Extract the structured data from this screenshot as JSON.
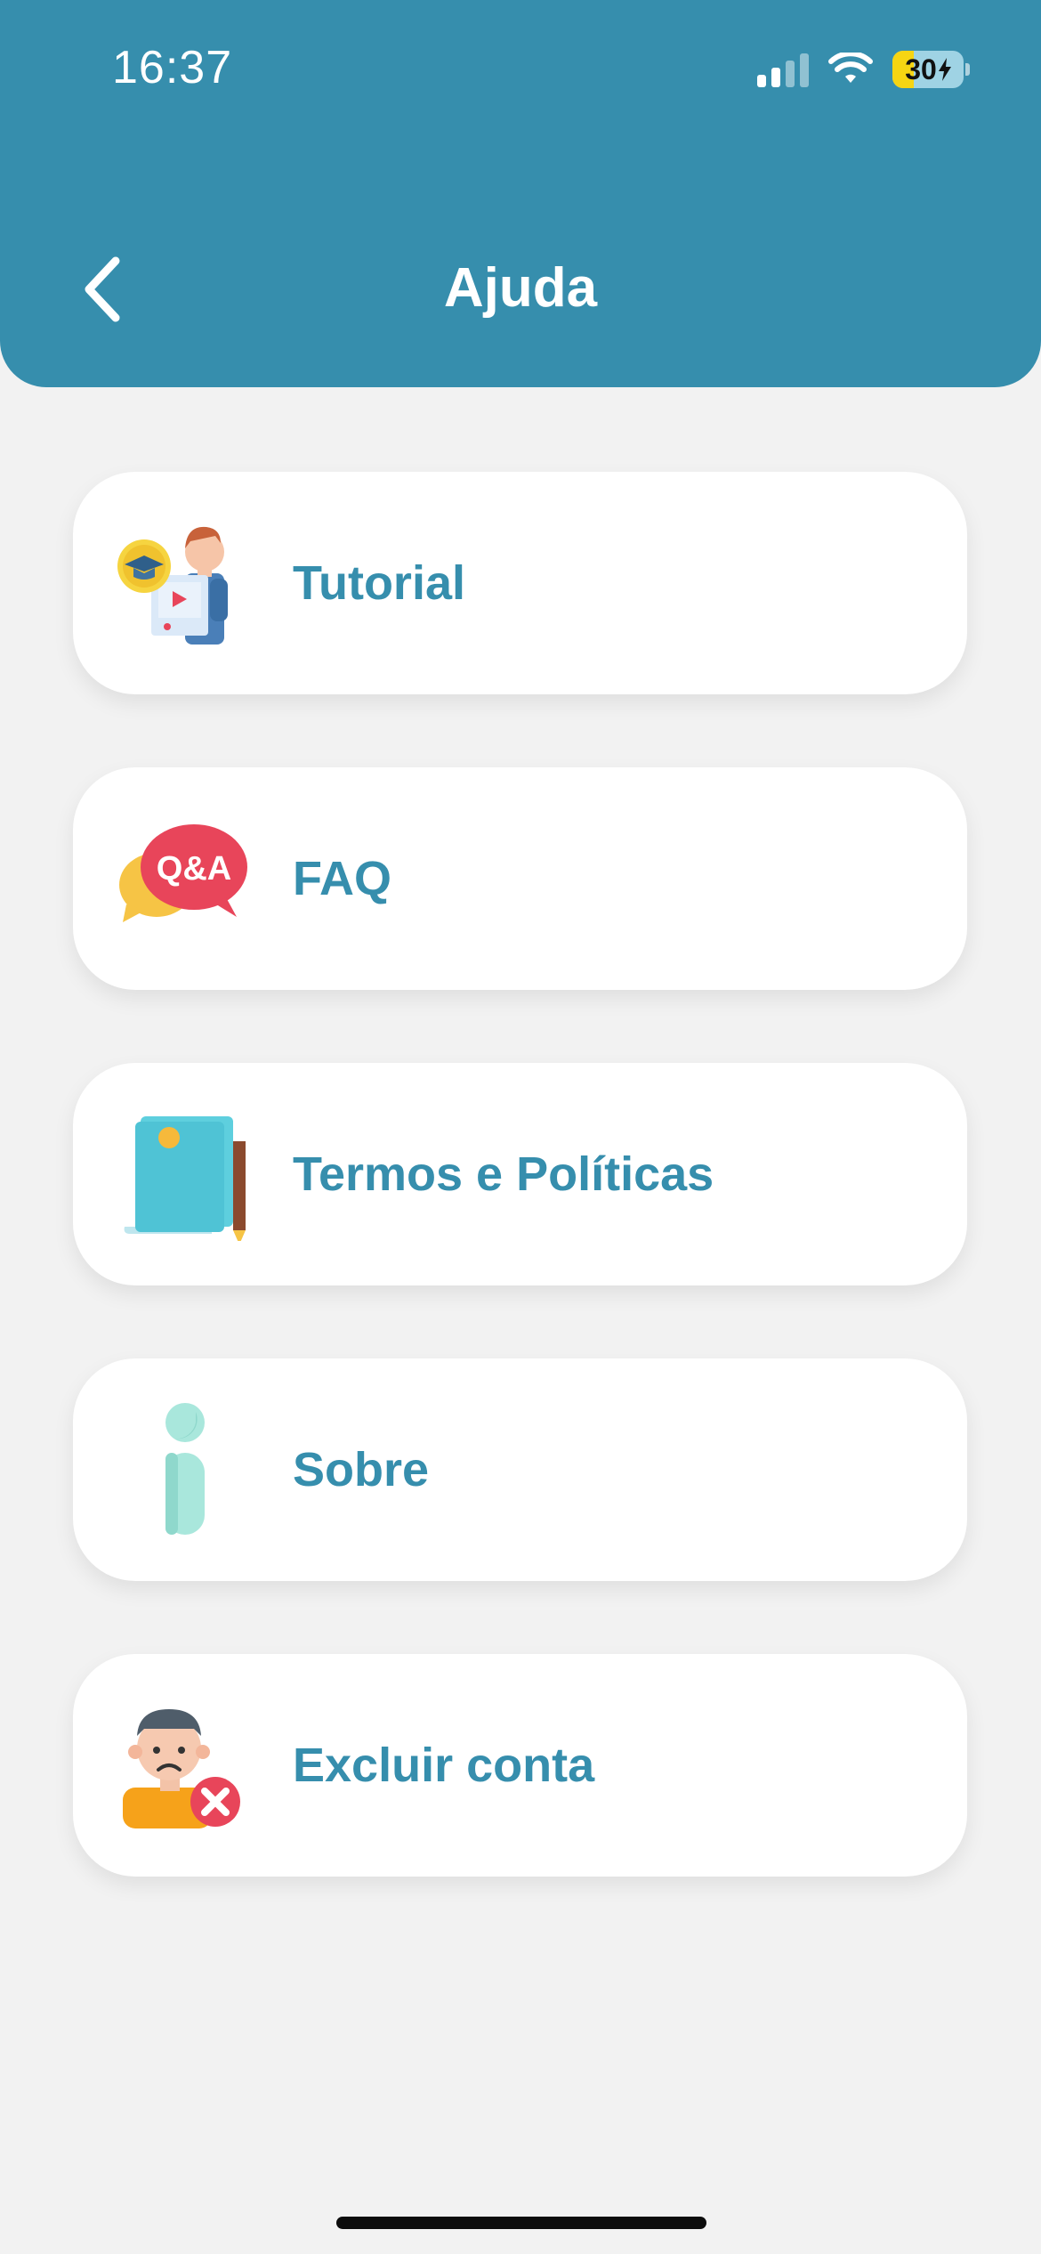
{
  "status_bar": {
    "time": "16:37",
    "battery_level": "30",
    "battery_percent": 30,
    "signal_bars": 2,
    "icons": [
      "signal-icon",
      "wifi-icon",
      "battery-charging-icon"
    ]
  },
  "header": {
    "title": "Ajuda",
    "back_icon": "chevron-left-icon"
  },
  "menu": {
    "items": [
      {
        "label": "Tutorial",
        "icon": "tutorial-video-icon"
      },
      {
        "label": "FAQ",
        "icon": "qa-bubbles-icon",
        "icon_text": "Q&A"
      },
      {
        "label": "Termos e Políticas",
        "icon": "document-pencil-icon"
      },
      {
        "label": "Sobre",
        "icon": "info-icon"
      },
      {
        "label": "Excluir conta",
        "icon": "delete-account-icon"
      }
    ]
  },
  "colors": {
    "primary": "#368ead",
    "background": "#f2f2f2",
    "card": "#ffffff",
    "battery_fill": "#f6d512"
  }
}
